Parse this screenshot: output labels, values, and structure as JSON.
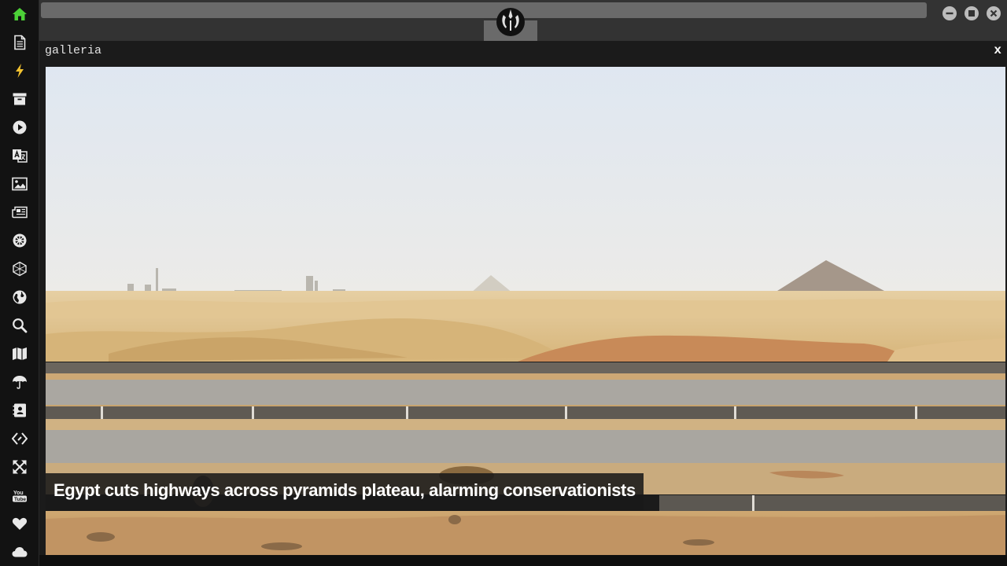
{
  "gallery": {
    "title": "galleria",
    "close_label": "x",
    "caption": "Egypt cuts highways across pyramids plateau, alarming conservationists"
  },
  "sidebar": {
    "items": [
      {
        "icon": "home-icon",
        "active": true
      },
      {
        "icon": "document-icon"
      },
      {
        "icon": "lightning-icon"
      },
      {
        "icon": "archive-icon"
      },
      {
        "icon": "play-icon"
      },
      {
        "icon": "translate-icon"
      },
      {
        "icon": "image-icon"
      },
      {
        "icon": "newspaper-icon"
      },
      {
        "icon": "empire-icon"
      },
      {
        "icon": "hexagon-icon"
      },
      {
        "icon": "globe-icon"
      },
      {
        "icon": "search-icon"
      },
      {
        "icon": "map-icon"
      },
      {
        "icon": "umbrella-icon"
      },
      {
        "icon": "contact-card-icon"
      },
      {
        "icon": "code-icon"
      },
      {
        "icon": "expand-icon"
      },
      {
        "icon": "youtube-icon"
      },
      {
        "icon": "heart-icon"
      },
      {
        "icon": "cloud-icon"
      }
    ]
  },
  "window": {
    "logo_icon": "rebel-alliance-icon",
    "controls": [
      "minimize-icon",
      "maximize-icon",
      "close-icon"
    ]
  },
  "colors": {
    "accent_active": "#4cd137",
    "sidebar_icon": "#e8e8e8",
    "sidebar_bg": "#121212",
    "topbar_bg": "#333333"
  }
}
